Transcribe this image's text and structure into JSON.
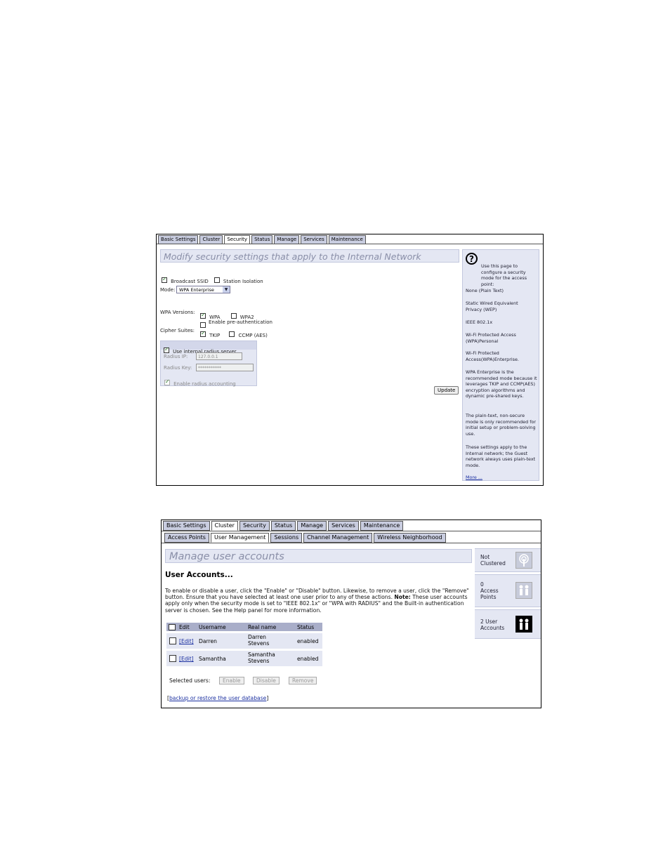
{
  "shot1": {
    "tabs": [
      "Basic Settings",
      "Cluster",
      "Security",
      "Status",
      "Manage",
      "Services",
      "Maintenance"
    ],
    "active_tab": "Security",
    "page_title": "Modify security settings that apply to the Internal Network",
    "broadcast_ssid_label": "Broadcast SSID",
    "station_isolation_label": "Station Isolation",
    "mode_label": "Mode:",
    "mode_value": "WPA Enterprise",
    "wpa_versions_label": "WPA Versions:",
    "wpa_label": "WPA",
    "wpa2_label": "WPA2",
    "preauth_label": "Enable pre-authentication",
    "cipher_label": "Cipher Suites:",
    "tkip_label": "TKIP",
    "ccmp_label": "CCMP (AES)",
    "use_radius_label": "Use internal radius server",
    "radius_ip_label": "Radius IP:",
    "radius_ip_value": "127.0.0.1",
    "radius_key_label": "Radius Key:",
    "radius_key_value": "***********",
    "radius_accounting_label": "Enable radius accounting",
    "update_label": "Update",
    "help": {
      "intro": "Use this page to configure a security mode for the access point:",
      "items": [
        "None (Plain Text)",
        "Static Wired Equivalent Privacy (WEP)",
        "IEEE 802.1x",
        "Wi-Fi Protected Access (WPA)Personal",
        "Wi-Fi Protected Access(WPA)Enterprise.",
        "WPA Enterprise is the recommended mode because it leverages TKIP and CCMP(AES) encryption algorithms and dynamic pre-shared keys.",
        "The plain-text, non-secure mode is only recommended for initial setup or problem-solving use.",
        "These settings apply to the Internal network; the Guest network always uses plain-text mode."
      ],
      "more": "More ..."
    }
  },
  "shot2": {
    "tabs": [
      "Basic Settings",
      "Cluster",
      "Security",
      "Status",
      "Manage",
      "Services",
      "Maintenance"
    ],
    "active_tab": "Cluster",
    "subtabs": [
      "Access Points",
      "User Management",
      "Sessions",
      "Channel Management",
      "Wireless Neighborhood"
    ],
    "active_subtab": "User Management",
    "page_title": "Manage user accounts",
    "section_title": "User Accounts...",
    "instructions": "To enable or disable a user, click the \"Enable\" or \"Disable\" button. Likewise, to remove a user, click the \"Remove\" button. Ensure that you have selected at least one user prior to any of these actions.",
    "note_label": "Note:",
    "note_text": "These user accounts apply only when the security mode is set to \"IEEE 802.1x\" or \"WPA with RADIUS\" and the Built-in authentication server is chosen. See the Help panel for more information.",
    "table_headers": [
      "Edit",
      "Username",
      "Real name",
      "Status"
    ],
    "rows": [
      {
        "edit": "[Edit]",
        "username": "Darren",
        "realname_1": "Darren",
        "realname_2": "Stevens",
        "status": "enabled"
      },
      {
        "edit": "[Edit]",
        "username": "Samantha",
        "realname_1": "Samantha",
        "realname_2": "Stevens",
        "status": "enabled"
      }
    ],
    "selected_users_label": "Selected users:",
    "enable_label": "Enable",
    "disable_label": "Disable",
    "remove_label": "Remove",
    "backup_link_open": "[",
    "backup_link": "backup or restore the user database",
    "backup_link_close": "]",
    "side": {
      "cluster_1": "Not",
      "cluster_2": "Clustered",
      "ap_1": "0",
      "ap_2": "Access",
      "ap_3": "Points",
      "users_1": "2 User",
      "users_2": "Accounts"
    }
  }
}
